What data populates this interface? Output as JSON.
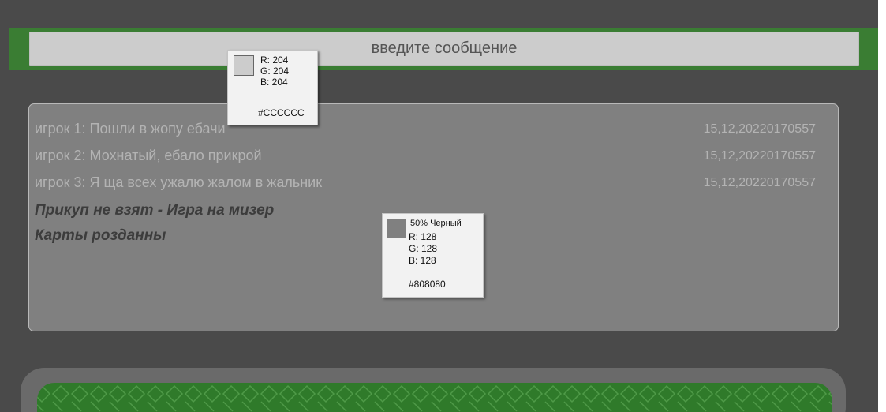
{
  "colors": {
    "background": "#4a4a4a",
    "accent_green": "#3a7d33",
    "input_bg": "#cccccc",
    "chat_bg": "#808080",
    "felt_green": "#2f7a2a"
  },
  "message_input": {
    "placeholder": "введите сообщение",
    "value": ""
  },
  "chat": {
    "messages": [
      {
        "text": "игрок 1: Пошли в жопу ебачи",
        "time": "15,12,20220170557"
      },
      {
        "text": "игрок 2: Мохнатый, ебало прикрой",
        "time": "15,12,20220170557"
      },
      {
        "text": "игрок 3: Я ща всех ужалю жалом в жальник",
        "time": "15,12,20220170557"
      }
    ],
    "system": [
      "Прикуп не взят - Игра на мизер",
      "Карты розданны"
    ]
  },
  "color_tooltips": [
    {
      "swatch": "#cccccc",
      "lines": [
        "R: 204",
        "G: 204",
        "B: 204"
      ],
      "hex": "#CCCCCC"
    },
    {
      "swatch": "#808080",
      "name": "50% Черный",
      "lines": [
        "R: 128",
        "G: 128",
        "B: 128"
      ],
      "hex": "#808080"
    }
  ],
  "game_table": {
    "pattern_icon": "card-suit-pattern"
  }
}
